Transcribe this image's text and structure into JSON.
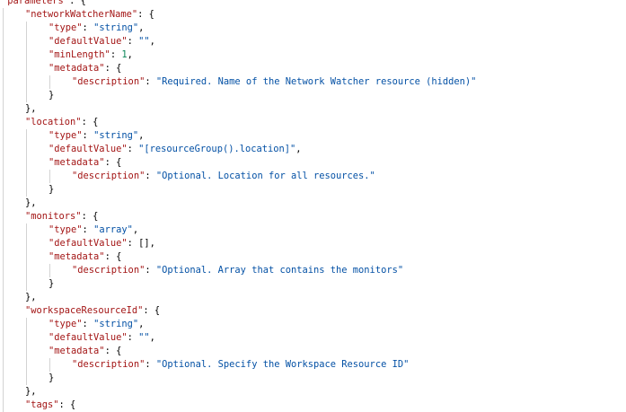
{
  "editor": {
    "language": "json",
    "lines": [
      {
        "indent": 0,
        "tokens": [
          {
            "t": "key",
            "v": "\"parameters\""
          },
          {
            "t": "pun",
            "v": ": {"
          }
        ]
      },
      {
        "indent": 1,
        "tokens": [
          {
            "t": "key",
            "v": "\"networkWatcherName\""
          },
          {
            "t": "pun",
            "v": ": {"
          }
        ]
      },
      {
        "indent": 2,
        "tokens": [
          {
            "t": "key",
            "v": "\"type\""
          },
          {
            "t": "pun",
            "v": ": "
          },
          {
            "t": "str",
            "v": "\"string\""
          },
          {
            "t": "pun",
            "v": ","
          }
        ]
      },
      {
        "indent": 2,
        "tokens": [
          {
            "t": "key",
            "v": "\"defaultValue\""
          },
          {
            "t": "pun",
            "v": ": "
          },
          {
            "t": "str",
            "v": "\"\""
          },
          {
            "t": "pun",
            "v": ","
          }
        ]
      },
      {
        "indent": 2,
        "tokens": [
          {
            "t": "key",
            "v": "\"minLength\""
          },
          {
            "t": "pun",
            "v": ": "
          },
          {
            "t": "num",
            "v": "1"
          },
          {
            "t": "pun",
            "v": ","
          }
        ]
      },
      {
        "indent": 2,
        "tokens": [
          {
            "t": "key",
            "v": "\"metadata\""
          },
          {
            "t": "pun",
            "v": ": {"
          }
        ]
      },
      {
        "indent": 3,
        "tokens": [
          {
            "t": "key",
            "v": "\"description\""
          },
          {
            "t": "pun",
            "v": ": "
          },
          {
            "t": "str",
            "v": "\"Required. Name of the Network Watcher resource (hidden)\""
          }
        ]
      },
      {
        "indent": 2,
        "tokens": [
          {
            "t": "pun",
            "v": "}"
          }
        ]
      },
      {
        "indent": 1,
        "tokens": [
          {
            "t": "pun",
            "v": "},"
          }
        ]
      },
      {
        "indent": 1,
        "tokens": [
          {
            "t": "key",
            "v": "\"location\""
          },
          {
            "t": "pun",
            "v": ": {"
          }
        ]
      },
      {
        "indent": 2,
        "tokens": [
          {
            "t": "key",
            "v": "\"type\""
          },
          {
            "t": "pun",
            "v": ": "
          },
          {
            "t": "str",
            "v": "\"string\""
          },
          {
            "t": "pun",
            "v": ","
          }
        ]
      },
      {
        "indent": 2,
        "tokens": [
          {
            "t": "key",
            "v": "\"defaultValue\""
          },
          {
            "t": "pun",
            "v": ": "
          },
          {
            "t": "str",
            "v": "\"[resourceGroup().location]\""
          },
          {
            "t": "pun",
            "v": ","
          }
        ]
      },
      {
        "indent": 2,
        "tokens": [
          {
            "t": "key",
            "v": "\"metadata\""
          },
          {
            "t": "pun",
            "v": ": {"
          }
        ]
      },
      {
        "indent": 3,
        "tokens": [
          {
            "t": "key",
            "v": "\"description\""
          },
          {
            "t": "pun",
            "v": ": "
          },
          {
            "t": "str",
            "v": "\"Optional. Location for all resources.\""
          }
        ]
      },
      {
        "indent": 2,
        "tokens": [
          {
            "t": "pun",
            "v": "}"
          }
        ]
      },
      {
        "indent": 1,
        "tokens": [
          {
            "t": "pun",
            "v": "},"
          }
        ]
      },
      {
        "indent": 1,
        "tokens": [
          {
            "t": "key",
            "v": "\"monitors\""
          },
          {
            "t": "pun",
            "v": ": {"
          }
        ]
      },
      {
        "indent": 2,
        "tokens": [
          {
            "t": "key",
            "v": "\"type\""
          },
          {
            "t": "pun",
            "v": ": "
          },
          {
            "t": "str",
            "v": "\"array\""
          },
          {
            "t": "pun",
            "v": ","
          }
        ]
      },
      {
        "indent": 2,
        "tokens": [
          {
            "t": "key",
            "v": "\"defaultValue\""
          },
          {
            "t": "pun",
            "v": ": [],"
          }
        ]
      },
      {
        "indent": 2,
        "tokens": [
          {
            "t": "key",
            "v": "\"metadata\""
          },
          {
            "t": "pun",
            "v": ": {"
          }
        ]
      },
      {
        "indent": 3,
        "tokens": [
          {
            "t": "key",
            "v": "\"description\""
          },
          {
            "t": "pun",
            "v": ": "
          },
          {
            "t": "str",
            "v": "\"Optional. Array that contains the monitors\""
          }
        ]
      },
      {
        "indent": 2,
        "tokens": [
          {
            "t": "pun",
            "v": "}"
          }
        ]
      },
      {
        "indent": 1,
        "tokens": [
          {
            "t": "pun",
            "v": "},"
          }
        ]
      },
      {
        "indent": 1,
        "tokens": [
          {
            "t": "key",
            "v": "\"workspaceResourceId\""
          },
          {
            "t": "pun",
            "v": ": {"
          }
        ]
      },
      {
        "indent": 2,
        "tokens": [
          {
            "t": "key",
            "v": "\"type\""
          },
          {
            "t": "pun",
            "v": ": "
          },
          {
            "t": "str",
            "v": "\"string\""
          },
          {
            "t": "pun",
            "v": ","
          }
        ]
      },
      {
        "indent": 2,
        "tokens": [
          {
            "t": "key",
            "v": "\"defaultValue\""
          },
          {
            "t": "pun",
            "v": ": "
          },
          {
            "t": "str",
            "v": "\"\""
          },
          {
            "t": "pun",
            "v": ","
          }
        ]
      },
      {
        "indent": 2,
        "tokens": [
          {
            "t": "key",
            "v": "\"metadata\""
          },
          {
            "t": "pun",
            "v": ": {"
          }
        ]
      },
      {
        "indent": 3,
        "tokens": [
          {
            "t": "key",
            "v": "\"description\""
          },
          {
            "t": "pun",
            "v": ": "
          },
          {
            "t": "str",
            "v": "\"Optional. Specify the Workspace Resource ID\""
          }
        ]
      },
      {
        "indent": 2,
        "tokens": [
          {
            "t": "pun",
            "v": "}"
          }
        ]
      },
      {
        "indent": 1,
        "tokens": [
          {
            "t": "pun",
            "v": "},"
          }
        ]
      },
      {
        "indent": 1,
        "tokens": [
          {
            "t": "key",
            "v": "\"tags\""
          },
          {
            "t": "pun",
            "v": ": {"
          }
        ]
      }
    ]
  },
  "colors": {
    "key": "#a31515",
    "string": "#0451a5",
    "number": "#098658",
    "punctuation": "#000000",
    "indent_guide": "#d3d3d3",
    "background": "#ffffff"
  }
}
